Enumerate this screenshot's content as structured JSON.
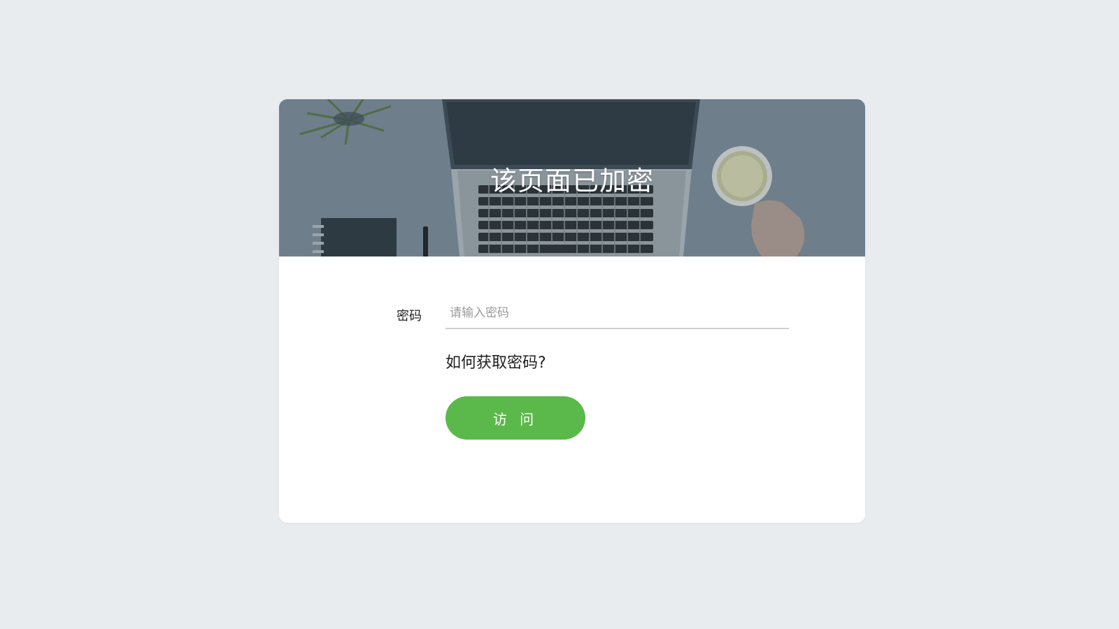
{
  "banner": {
    "title": "该页面已加密"
  },
  "form": {
    "password_label": "密码",
    "password_placeholder": "请输入密码",
    "password_value": "",
    "help_link": "如何获取密码?",
    "visit_button": "访 问"
  },
  "colors": {
    "page_background": "#e8ecee",
    "card_background": "#ffffff",
    "banner_overlay": "#6f7f8c",
    "button_green": "#5ab94a",
    "input_underline": "#cfcfcf"
  }
}
